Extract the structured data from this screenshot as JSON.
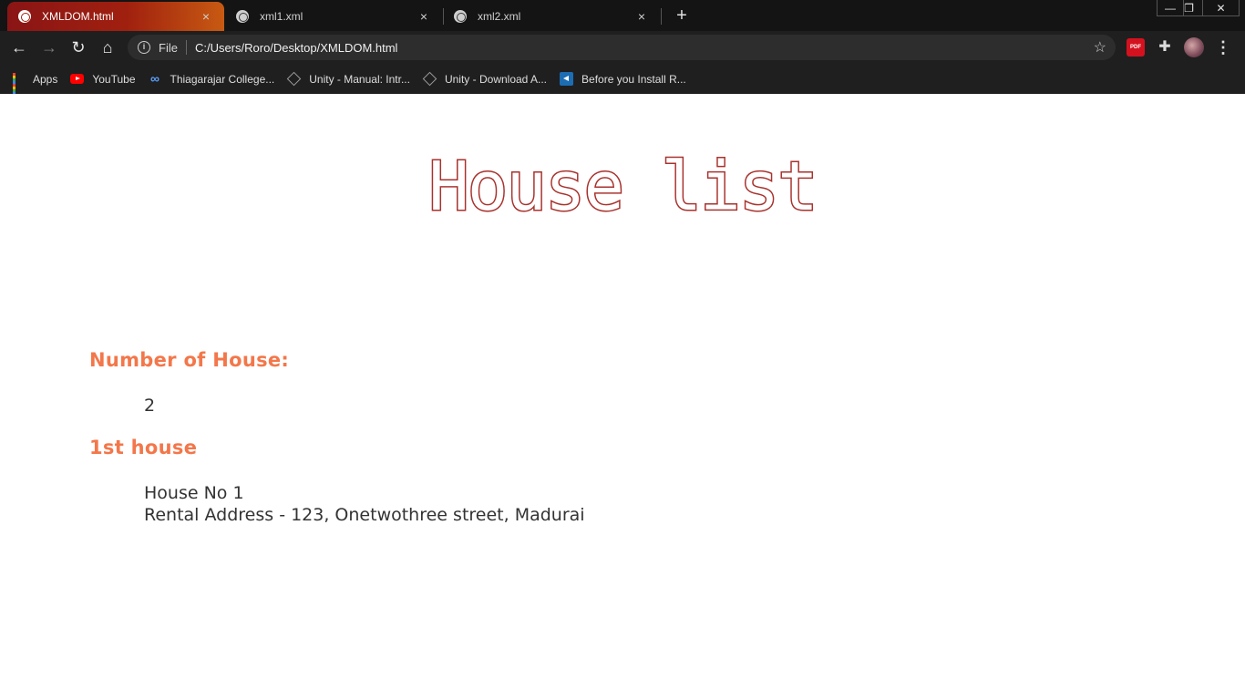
{
  "browser": {
    "tabs": [
      {
        "label": "XMLDOM.html",
        "active": true
      },
      {
        "label": "xml1.xml",
        "active": false
      },
      {
        "label": "xml2.xml",
        "active": false
      }
    ],
    "close_glyph": "×",
    "new_tab_glyph": "+",
    "window_controls": {
      "minimize": "—",
      "restore": "❐",
      "close": "✕"
    },
    "nav": {
      "back": "←",
      "forward": "→",
      "reload": "↻",
      "home": "⌂"
    },
    "omnibox": {
      "scheme_label": "File",
      "url": "C:/Users/Roro/Desktop/XMLDOM.html"
    },
    "extensions": {
      "pdf_label": "PDF",
      "menu": "⋮"
    },
    "bookmarks": [
      {
        "label": "Apps",
        "icon": "apps-grid-icon"
      },
      {
        "label": "YouTube",
        "icon": "youtube-icon"
      },
      {
        "label": "Thiagarajar College...",
        "icon": "link-icon"
      },
      {
        "label": "Unity - Manual: Intr...",
        "icon": "unity-icon"
      },
      {
        "label": "Unity - Download A...",
        "icon": "unity-icon"
      },
      {
        "label": "Before you Install R...",
        "icon": "visual-studio-icon"
      }
    ],
    "accent_colors": {
      "active_tab_start": "#8a1515",
      "active_tab_end": "#c85a12"
    }
  },
  "page": {
    "title": "House list",
    "sections": {
      "count_heading": "Number of House:",
      "count_value": "2",
      "first_heading": "1st house",
      "first_line1": "House No 1",
      "first_line2": "Rental Address - 123, Onetwothree street, Madurai"
    },
    "colors": {
      "title": "#a8322d",
      "heading": "#f3774a"
    }
  }
}
